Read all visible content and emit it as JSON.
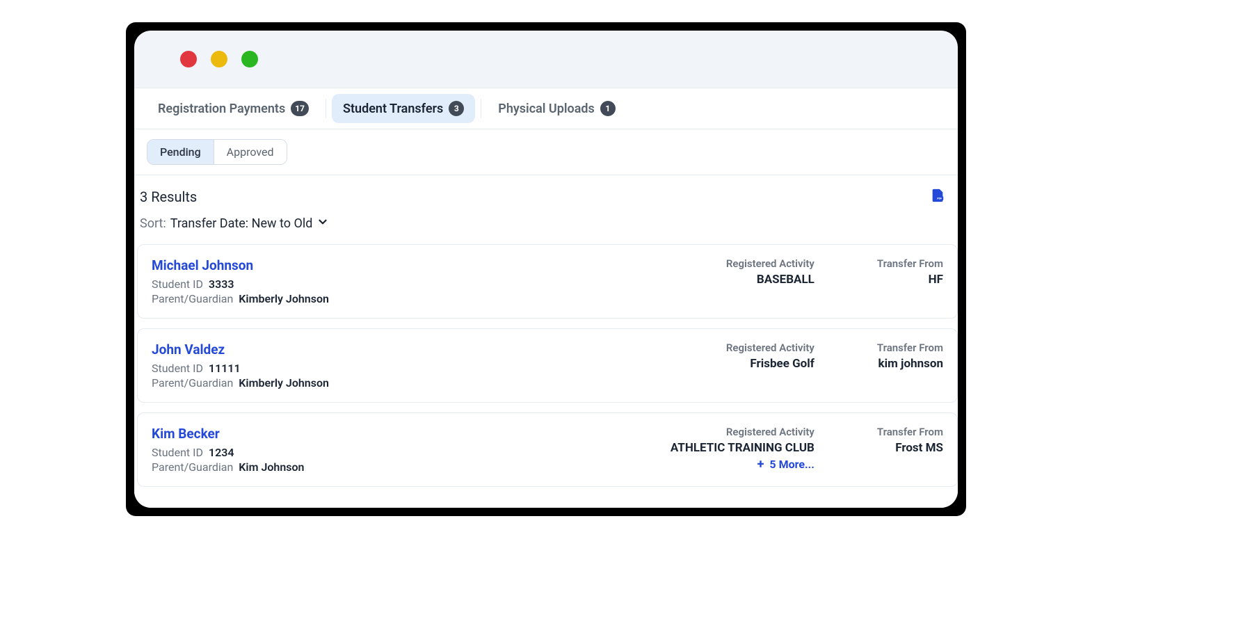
{
  "tabs": [
    {
      "label": "Registration Payments",
      "count": "17",
      "active": false
    },
    {
      "label": "Student Transfers",
      "count": "3",
      "active": true
    },
    {
      "label": "Physical Uploads",
      "count": "1",
      "active": false
    }
  ],
  "filters": {
    "pending": "Pending",
    "approved": "Approved"
  },
  "results": {
    "count_text": "3 Results",
    "sort_label": "Sort:",
    "sort_value": "Transfer Date: New to Old"
  },
  "columns": {
    "registered_activity": "Registered Activity",
    "transfer_from": "Transfer From",
    "student_id": "Student ID",
    "parent_guardian": "Parent/Guardian"
  },
  "cards": [
    {
      "name": "Michael Johnson",
      "student_id": "3333",
      "guardian": "Kimberly Johnson",
      "activity": "BASEBALL",
      "transfer_from": "HF",
      "more": null
    },
    {
      "name": "John Valdez",
      "student_id": "11111",
      "guardian": "Kimberly Johnson",
      "activity": "Frisbee Golf",
      "transfer_from": "kim johnson",
      "more": null
    },
    {
      "name": "Kim Becker",
      "student_id": "1234",
      "guardian": "Kim Johnson",
      "activity": "ATHLETIC TRAINING CLUB",
      "transfer_from": "Frost MS",
      "more": "5 More..."
    }
  ]
}
